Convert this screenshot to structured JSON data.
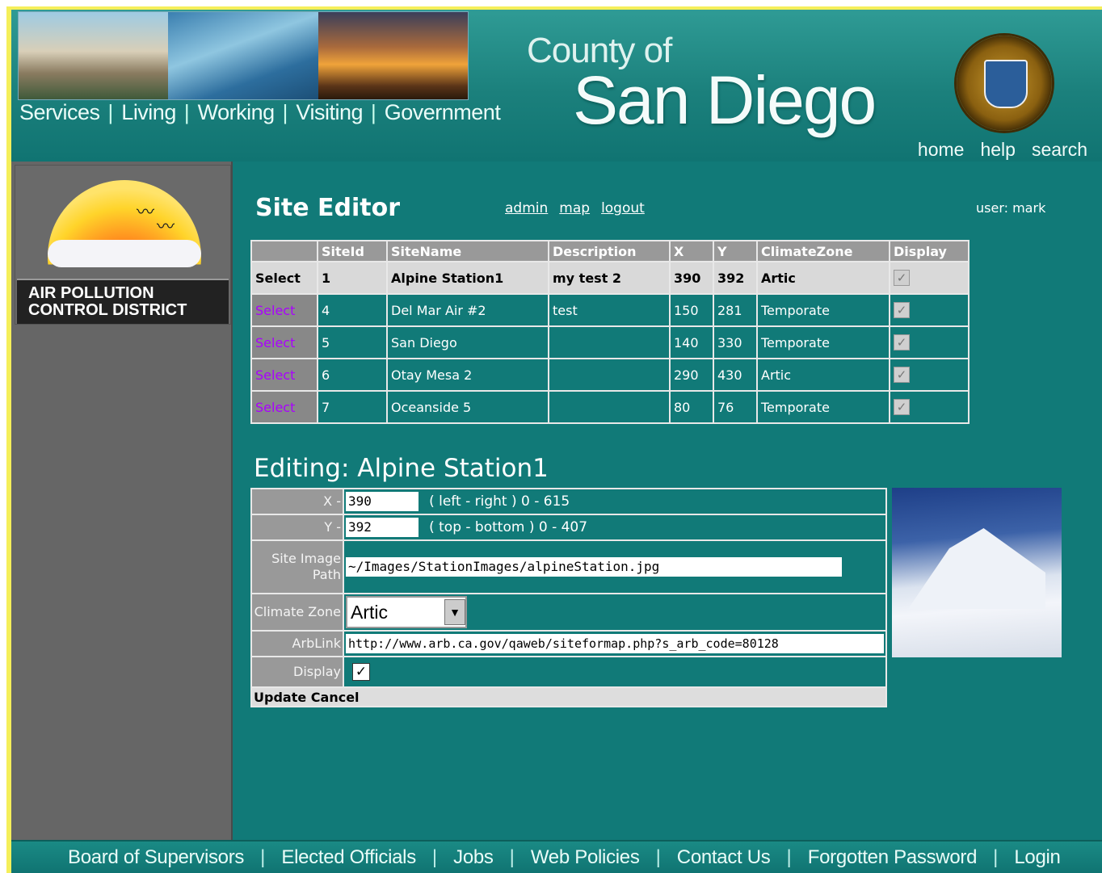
{
  "header": {
    "nav": [
      "Services",
      "Living",
      "Working",
      "Visiting",
      "Government"
    ],
    "county_of": "County of",
    "san_diego": "San Diego",
    "util_links": [
      "home",
      "help",
      "search"
    ]
  },
  "sidebar": {
    "logo_text_line1": "AIR POLLUTION",
    "logo_text_line2": "CONTROL DISTRICT"
  },
  "main": {
    "title": "Site Editor",
    "links": [
      "admin",
      "map",
      "logout"
    ],
    "user": "user: mark",
    "table": {
      "headers": [
        "",
        "SiteId",
        "SiteName",
        "Description",
        "X",
        "Y",
        "ClimateZone",
        "Display"
      ],
      "rows": [
        {
          "select": "Select",
          "site_id": "1",
          "site_name": "Alpine Station1",
          "description": "my test 2",
          "x": "390",
          "y": "392",
          "zone": "Artic",
          "display": true
        },
        {
          "select": "Select",
          "site_id": "4",
          "site_name": "Del Mar Air #2",
          "description": "test",
          "x": "150",
          "y": "281",
          "zone": "Temporate",
          "display": true
        },
        {
          "select": "Select",
          "site_id": "5",
          "site_name": "San Diego",
          "description": "",
          "x": "140",
          "y": "330",
          "zone": "Temporate",
          "display": true
        },
        {
          "select": "Select",
          "site_id": "6",
          "site_name": "Otay Mesa 2",
          "description": "",
          "x": "290",
          "y": "430",
          "zone": "Artic",
          "display": true
        },
        {
          "select": "Select",
          "site_id": "7",
          "site_name": "Oceanside 5",
          "description": "",
          "x": "80",
          "y": "76",
          "zone": "Temporate",
          "display": true
        }
      ]
    },
    "editing_title": "Editing: Alpine Station1",
    "form": {
      "x_label": "X -",
      "x_value": "390",
      "x_hint": "( left - right ) 0 - 615",
      "y_label": "Y -",
      "y_value": "392",
      "y_hint": "( top - bottom ) 0 - 407",
      "image_label": "Site Image Path",
      "image_value": "~/Images/StationImages/alpineStation.jpg",
      "zone_label": "Climate Zone",
      "zone_value": "Artic",
      "arblink_label": "ArbLink",
      "arblink_value": "http://www.arb.ca.gov/qaweb/siteformap.php?s_arb_code=80128",
      "display_label": "Display",
      "display_checked": true,
      "update_label": "Update",
      "cancel_label": "Cancel"
    }
  },
  "footer": {
    "links": [
      "Board of Supervisors",
      "Elected Officials",
      "Jobs",
      "Web Policies",
      "Contact Us",
      "Forgotten Password",
      "Login"
    ]
  },
  "icons": {
    "checkbox": "✓",
    "dropdown": "▼"
  }
}
